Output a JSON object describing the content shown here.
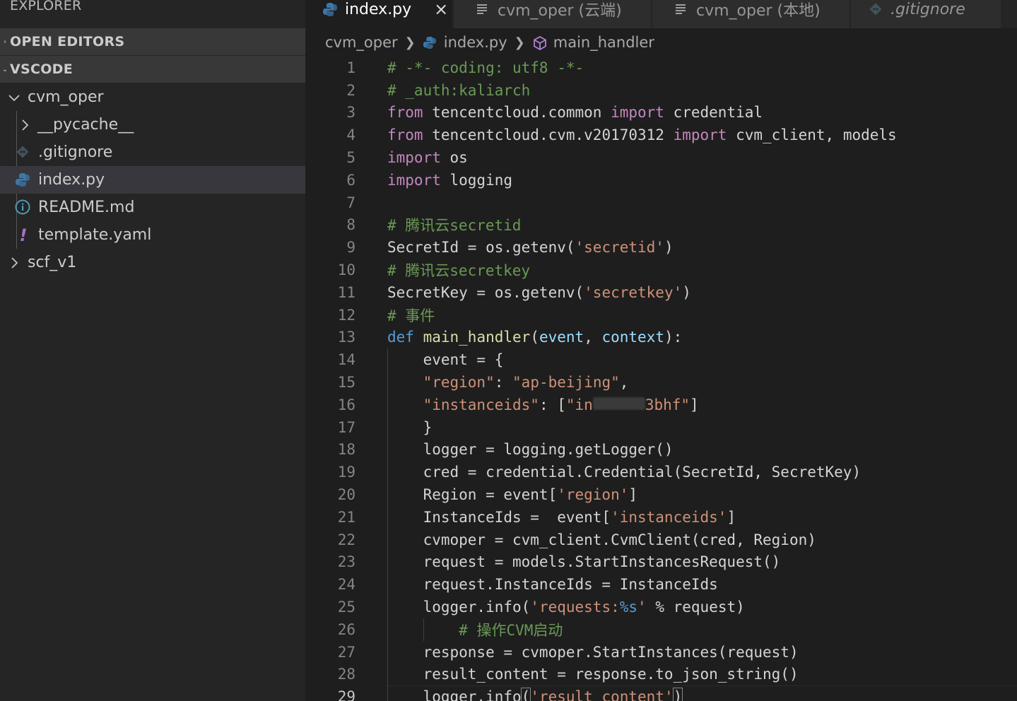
{
  "sidebar": {
    "title": "EXPLORER",
    "open_editors_label": "OPEN EDITORS",
    "workspace_label": "VSCODE",
    "tree": [
      {
        "label": "cvm_oper",
        "kind": "folder-open"
      },
      {
        "label": "__pycache__",
        "kind": "folder"
      },
      {
        "label": ".gitignore",
        "kind": "git"
      },
      {
        "label": "index.py",
        "kind": "python",
        "selected": true
      },
      {
        "label": "README.md",
        "kind": "info"
      },
      {
        "label": "template.yaml",
        "kind": "yaml"
      },
      {
        "label": "scf_v1",
        "kind": "folder"
      }
    ]
  },
  "tabs": [
    {
      "label": "index.py",
      "active": true,
      "icon": "python-icon"
    },
    {
      "label": "cvm_oper (云端)",
      "icon": "lines-icon"
    },
    {
      "label": "cvm_oper (本地)",
      "icon": "lines-icon"
    },
    {
      "label": ".gitignore",
      "icon": "git-icon",
      "italic": true
    }
  ],
  "breadcrumb": {
    "folder": "cvm_oper",
    "file": "index.py",
    "symbol": "main_handler"
  },
  "code": {
    "current_line": 29,
    "lines": [
      [
        [
          "cm",
          "# -*- coding: utf8 -*-"
        ]
      ],
      [
        [
          "cm",
          "# _auth:kaliarch"
        ]
      ],
      [
        [
          "kw",
          "from"
        ],
        [
          "plain",
          " tencentcloud.common "
        ],
        [
          "kw",
          "import"
        ],
        [
          "plain",
          " credential"
        ]
      ],
      [
        [
          "kw",
          "from"
        ],
        [
          "plain",
          " tencentcloud.cvm.v20170312 "
        ],
        [
          "kw",
          "import"
        ],
        [
          "plain",
          " cvm_client, models"
        ]
      ],
      [
        [
          "kw",
          "import"
        ],
        [
          "plain",
          " os"
        ]
      ],
      [
        [
          "kw",
          "import"
        ],
        [
          "plain",
          " logging"
        ]
      ],
      [],
      [
        [
          "cm",
          "# 腾讯云secretid"
        ]
      ],
      [
        [
          "plain",
          "SecretId = os.getenv("
        ],
        [
          "str",
          "'secretid'"
        ],
        [
          "plain",
          ")"
        ]
      ],
      [
        [
          "cm",
          "# 腾讯云secretkey"
        ]
      ],
      [
        [
          "plain",
          "SecretKey = os.getenv("
        ],
        [
          "str",
          "'secretkey'"
        ],
        [
          "plain",
          ")"
        ]
      ],
      [
        [
          "cm",
          "# 事件"
        ]
      ],
      [
        [
          "def",
          "def"
        ],
        [
          "plain",
          " "
        ],
        [
          "fn",
          "main_handler"
        ],
        [
          "plain",
          "("
        ],
        [
          "param",
          "event"
        ],
        [
          "plain",
          ", "
        ],
        [
          "param",
          "context"
        ],
        [
          "plain",
          "):"
        ]
      ],
      [
        [
          "plain",
          "    event = {"
        ]
      ],
      [
        [
          "plain",
          "    "
        ],
        [
          "str",
          "\"region\""
        ],
        [
          "plain",
          ": "
        ],
        [
          "str",
          "\"ap-beijing\""
        ],
        [
          "plain",
          ","
        ]
      ],
      [
        [
          "plain",
          "    "
        ],
        [
          "str",
          "\"instanceids\""
        ],
        [
          "plain",
          ": ["
        ],
        [
          "str",
          "\"in"
        ],
        [
          "blur",
          "xxxxxxx"
        ],
        [
          "str",
          "3bhf\""
        ],
        [
          "plain",
          "]"
        ]
      ],
      [
        [
          "plain",
          "    }"
        ]
      ],
      [
        [
          "plain",
          "    logger = logging.getLogger()"
        ]
      ],
      [
        [
          "plain",
          "    cred = credential.Credential(SecretId, SecretKey)"
        ]
      ],
      [
        [
          "plain",
          "    Region = event["
        ],
        [
          "str",
          "'region'"
        ],
        [
          "plain",
          "]"
        ]
      ],
      [
        [
          "plain",
          "    InstanceIds =  event["
        ],
        [
          "str",
          "'instanceids'"
        ],
        [
          "plain",
          "]"
        ]
      ],
      [
        [
          "plain",
          "    cvmoper = cvm_client.CvmClient(cred, Region)"
        ]
      ],
      [
        [
          "plain",
          "    request = models.StartInstancesRequest()"
        ]
      ],
      [
        [
          "plain",
          "    request.InstanceIds = InstanceIds"
        ]
      ],
      [
        [
          "plain",
          "    logger.info("
        ],
        [
          "str",
          "'requests:"
        ],
        [
          "fmt",
          "%s"
        ],
        [
          "str",
          "'"
        ],
        [
          "plain",
          " % request)"
        ]
      ],
      [
        [
          "plain",
          "        "
        ],
        [
          "cm",
          "# 操作CVM启动"
        ]
      ],
      [
        [
          "plain",
          "    response = cvmoper.StartInstances(request)"
        ]
      ],
      [
        [
          "plain",
          "    result_content = response.to_json_string()"
        ]
      ],
      [
        [
          "plain",
          "    logger.info"
        ],
        [
          "brk",
          "("
        ],
        [
          "str",
          "'result_content'"
        ],
        [
          "brk",
          ")"
        ]
      ]
    ]
  },
  "colors": {
    "comment": "#6a9955",
    "keyword": "#c586c0",
    "string": "#ce9178",
    "function": "#dcdcaa",
    "param": "#9cdcfe"
  }
}
